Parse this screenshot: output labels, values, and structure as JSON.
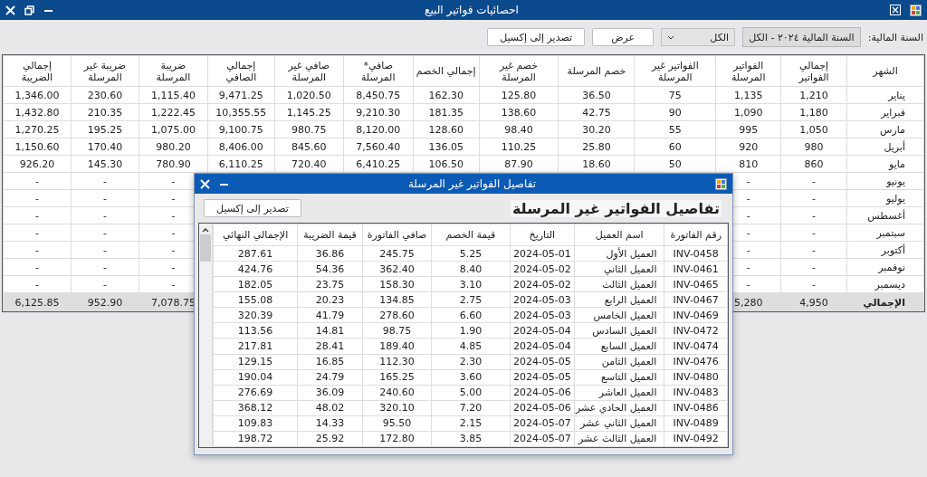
{
  "window": {
    "title": "احصائيات فواتير البيع"
  },
  "toolbar": {
    "label": "السنة المالية:",
    "year_combo": "السنة المالية ٢٠٢٤ - الكل",
    "filter_dropdown": "الكل",
    "buttons": [
      "عرض",
      "تصدير إلى إكسيل"
    ]
  },
  "table": {
    "columns": [
      "الشهر",
      "إجمالي\nالفواتير",
      "الفواتير\nالمرسلة",
      "الفواتير غير\nالمرسلة",
      "خصم المرسلة",
      "خصم غير\nالمرسلة",
      "إجمالي الخصم",
      "صافي*\nالمرسلة",
      "صافي غير\nالمرسلة",
      "إجمالي\nالصافي",
      "ضريبة\nالمرسلة",
      "ضريبة غير\nالمرسلة",
      "إجمالي\nالضريبة"
    ],
    "rows": [
      {
        "kind": "month",
        "cells": [
          "يناير",
          "1,210",
          "1,135",
          "75",
          "36.50",
          "125.80",
          "162.30",
          "8,450.75",
          "1,020.50",
          "9,471.25",
          "1,115.40",
          "230.60",
          "1,346.00"
        ]
      },
      {
        "kind": "month",
        "cells": [
          "فبراير",
          "1,180",
          "1,090",
          "90",
          "42.75",
          "138.60",
          "181.35",
          "9,210.30",
          "1,145.25",
          "10,355.55",
          "1,222.45",
          "210.35",
          "1,432.80"
        ]
      },
      {
        "kind": "month",
        "cells": [
          "مارس",
          "1,050",
          "995",
          "55",
          "30.20",
          "98.40",
          "128.60",
          "8,120.00",
          "980.75",
          "9,100.75",
          "1,075.00",
          "195.25",
          "1,270.25"
        ]
      },
      {
        "kind": "month",
        "cells": [
          "أبريل",
          "980",
          "920",
          "60",
          "25.80",
          "110.25",
          "136.05",
          "7,560.40",
          "845.60",
          "8,406.00",
          "980.20",
          "170.40",
          "1,150.60"
        ]
      },
      {
        "kind": "month",
        "cells": [
          "مايو",
          "860",
          "810",
          "50",
          "18.60",
          "87.90",
          "106.50",
          "6,410.25",
          "720.40",
          "6,110.25",
          "780.90",
          "145.30",
          "926.20"
        ]
      },
      {
        "kind": "month",
        "cells": [
          "يونيو",
          "-",
          "-",
          null,
          null,
          null,
          null,
          null,
          null,
          null,
          "-",
          "-",
          "-"
        ]
      },
      {
        "kind": "month",
        "cells": [
          "يوليو",
          "-",
          "-",
          null,
          null,
          null,
          null,
          null,
          null,
          null,
          "-",
          "-",
          "-"
        ]
      },
      {
        "kind": "month",
        "cells": [
          "أغسطس",
          "-",
          "-",
          null,
          null,
          null,
          null,
          null,
          null,
          null,
          "-",
          "-",
          "-"
        ]
      },
      {
        "kind": "month",
        "cells": [
          "سبتمبر",
          "-",
          "-",
          null,
          null,
          null,
          null,
          null,
          null,
          null,
          "-",
          "-",
          "-"
        ]
      },
      {
        "kind": "month",
        "cells": [
          "أكتوبر",
          "-",
          "-",
          null,
          null,
          null,
          null,
          null,
          null,
          null,
          "-",
          "-",
          "-"
        ]
      },
      {
        "kind": "month",
        "cells": [
          "نوفمبر",
          "-",
          "-",
          null,
          null,
          null,
          null,
          null,
          null,
          null,
          "-",
          "-",
          "-"
        ]
      },
      {
        "kind": "month",
        "cells": [
          "ديسمبر",
          "-",
          "-",
          null,
          null,
          null,
          null,
          null,
          null,
          null,
          "-",
          "-",
          "-"
        ]
      },
      {
        "kind": "total",
        "cells": [
          "الإجمالي",
          "4,950",
          "5,280",
          null,
          null,
          null,
          null,
          null,
          null,
          null,
          "7,078.75",
          "952.90",
          "6,125.85"
        ]
      }
    ]
  },
  "dialog": {
    "title": "تفاصيل الفواتير غير المرسلة",
    "heading": "تفاصيل الفواتير غير المرسلة",
    "export_button": "تصدير إلى إكسيل",
    "table": {
      "columns": [
        "رقم الفاتورة",
        "اسم العميل",
        "التاريخ",
        "قيمة الخصم",
        "صافي الفاتورة",
        "قيمة الضريبة",
        "الإجمالي النهائي"
      ],
      "rows": [
        [
          "INV-0458",
          "العميل الأول",
          "2024-05-01",
          "5.25",
          "245.75",
          "36.86",
          "287.61"
        ],
        [
          "INV-0461",
          "العميل الثاني",
          "2024-05-02",
          "8.40",
          "362.40",
          "54.36",
          "424.76"
        ],
        [
          "INV-0465",
          "العميل الثالث",
          "2024-05-02",
          "3.10",
          "158.30",
          "23.75",
          "182.05"
        ],
        [
          "INV-0467",
          "العميل الرابع",
          "2024-05-03",
          "2.75",
          "134.85",
          "20.23",
          "155.08"
        ],
        [
          "INV-0469",
          "العميل الخامس",
          "2024-05-03",
          "6.60",
          "278.60",
          "41.79",
          "320.39"
        ],
        [
          "INV-0472",
          "العميل السادس",
          "2024-05-04",
          "1.90",
          "98.75",
          "14.81",
          "113.56"
        ],
        [
          "INV-0474",
          "العميل السابع",
          "2024-05-04",
          "4.85",
          "189.40",
          "28.41",
          "217.81"
        ],
        [
          "INV-0476",
          "العميل الثامن",
          "2024-05-05",
          "2.30",
          "112.30",
          "16.85",
          "129.15"
        ],
        [
          "INV-0480",
          "العميل التاسع",
          "2024-05-05",
          "3.60",
          "165.25",
          "24.79",
          "190.04"
        ],
        [
          "INV-0483",
          "العميل العاشر",
          "2024-05-06",
          "5.00",
          "240.60",
          "36.09",
          "276.69"
        ],
        [
          "INV-0486",
          "العميل الحادي عشر",
          "2024-05-06",
          "7.20",
          "320.10",
          "48.02",
          "368.12"
        ],
        [
          "INV-0489",
          "العميل الثاني عشر",
          "2024-05-07",
          "2.15",
          "95.50",
          "14.33",
          "109.83"
        ],
        [
          "INV-0492",
          "العميل الثالث عشر",
          "2024-05-07",
          "3.85",
          "172.80",
          "25.92",
          "198.72"
        ]
      ]
    }
  }
}
